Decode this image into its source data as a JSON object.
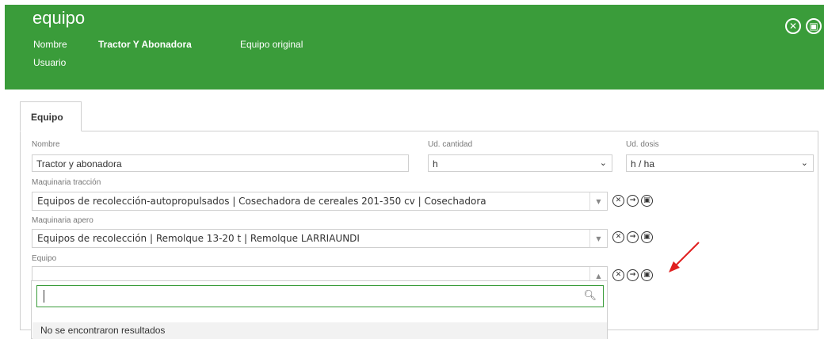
{
  "header": {
    "title": "equipo",
    "nombre_label": "Nombre",
    "nombre_value": "Tractor Y Abonadora",
    "original_link": "Equipo original",
    "usuario_label": "Usuario",
    "close_icon": "close-circle-icon",
    "save_icon": "save-circle-icon",
    "bg_color": "#3a9c3a"
  },
  "tabs": [
    {
      "label": "Equipo"
    }
  ],
  "form": {
    "nombre": {
      "label": "Nombre",
      "value": "Tractor y abonadora"
    },
    "ud_cantidad": {
      "label": "Ud. cantidad",
      "value": "h"
    },
    "ud_dosis": {
      "label": "Ud. dosis",
      "value": "h / ha"
    },
    "maquinaria_traccion": {
      "label": "Maquinaria tracción",
      "value": "Equipos de recolección-autopropulsados | Cosechadora de cereales 201-350 cv | Cosechadora"
    },
    "maquinaria_apero": {
      "label": "Maquinaria apero",
      "value": "Equipos de recolección | Remolque 13-20 t | Remolque LARRIAUNDI"
    },
    "equipo": {
      "label": "Equipo",
      "value": ""
    }
  },
  "dropdown": {
    "search_value": "",
    "no_results": "No se encontraron resultados"
  },
  "annotation": {
    "color": "#e02020"
  }
}
